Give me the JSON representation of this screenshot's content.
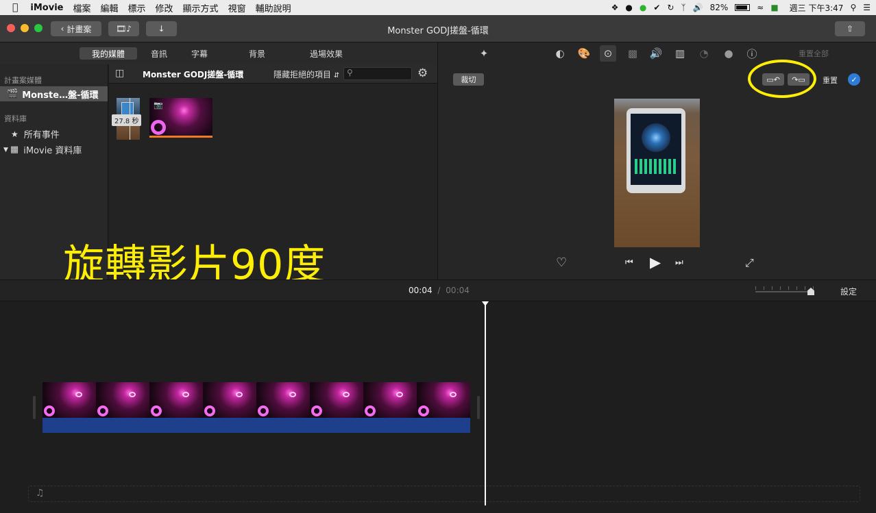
{
  "menubar": {
    "items": [
      "iMovie",
      "檔案",
      "編輯",
      "標示",
      "修改",
      "顯示方式",
      "視窗",
      "輔助說明"
    ],
    "battery": "82%",
    "clock": "週三 下午3:47"
  },
  "titlebar": {
    "back_label": "計畫案",
    "title": "Monster GODJ搓盤-循環"
  },
  "media_tabs": [
    "我的媒體",
    "音訊",
    "字幕",
    "背景",
    "過場效果"
  ],
  "sidebar": {
    "section1": "計畫案媒體",
    "project_item": "Monste…盤-循環",
    "section2": "資料庫",
    "all_events": "所有事件",
    "library": "iMovie 資料庫"
  },
  "browser": {
    "title": "Monster GODJ搓盤-循環",
    "filter": "隱藏拒絕的項目",
    "search_placeholder": "",
    "clip_duration": "27.8 秒"
  },
  "viewer": {
    "reset_all": "重置全部",
    "crop_label": "裁切",
    "reset_label": "重置"
  },
  "overlay_caption": "旋轉影片90度",
  "timeline": {
    "current_time": "00:04",
    "separator": "/",
    "total_time": "00:04",
    "settings_label": "設定"
  },
  "colors": {
    "accent_blue": "#2f7bd8",
    "highlight_yellow": "#ffee00",
    "audio_bar": "#1e3f8c"
  }
}
